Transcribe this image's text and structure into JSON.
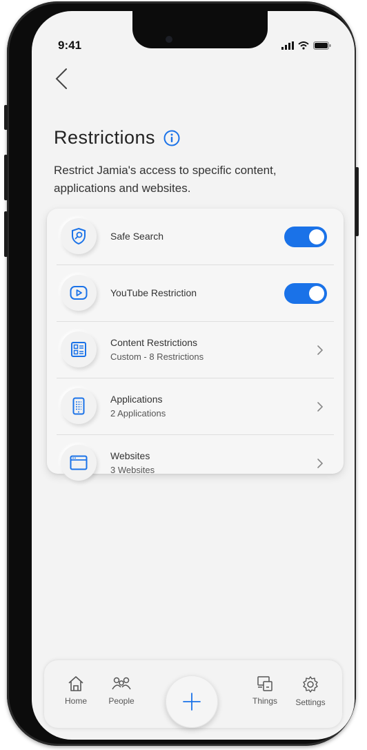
{
  "status_bar": {
    "time": "9:41"
  },
  "header": {
    "title": "Restrictions",
    "subtitle": "Restrict Jamia's access to specific content, applications and websites."
  },
  "restrictions": [
    {
      "label": "Safe Search",
      "icon": "shield-search-icon",
      "control": "toggle",
      "enabled": true
    },
    {
      "label": "YouTube Restriction",
      "icon": "youtube-play-icon",
      "control": "toggle",
      "enabled": true
    },
    {
      "label": "Content Restrictions",
      "sublabel": "Custom - 8 Restrictions",
      "icon": "content-grid-icon",
      "control": "chevron"
    },
    {
      "label": "Applications",
      "sublabel": "2 Applications",
      "icon": "phone-app-icon",
      "control": "chevron"
    },
    {
      "label": "Websites",
      "sublabel": "3 Websites",
      "icon": "browser-window-icon",
      "control": "chevron"
    }
  ],
  "tab_bar": {
    "tabs": [
      {
        "label": "Home",
        "icon": "home-icon"
      },
      {
        "label": "People",
        "icon": "people-icon"
      },
      {
        "label": "Things",
        "icon": "devices-icon"
      },
      {
        "label": "Settings",
        "icon": "gear-icon"
      }
    ],
    "fab_icon": "plus-icon"
  },
  "colors": {
    "accent": "#1a72e8",
    "background": "#f3f3f3",
    "text": "#222222"
  }
}
